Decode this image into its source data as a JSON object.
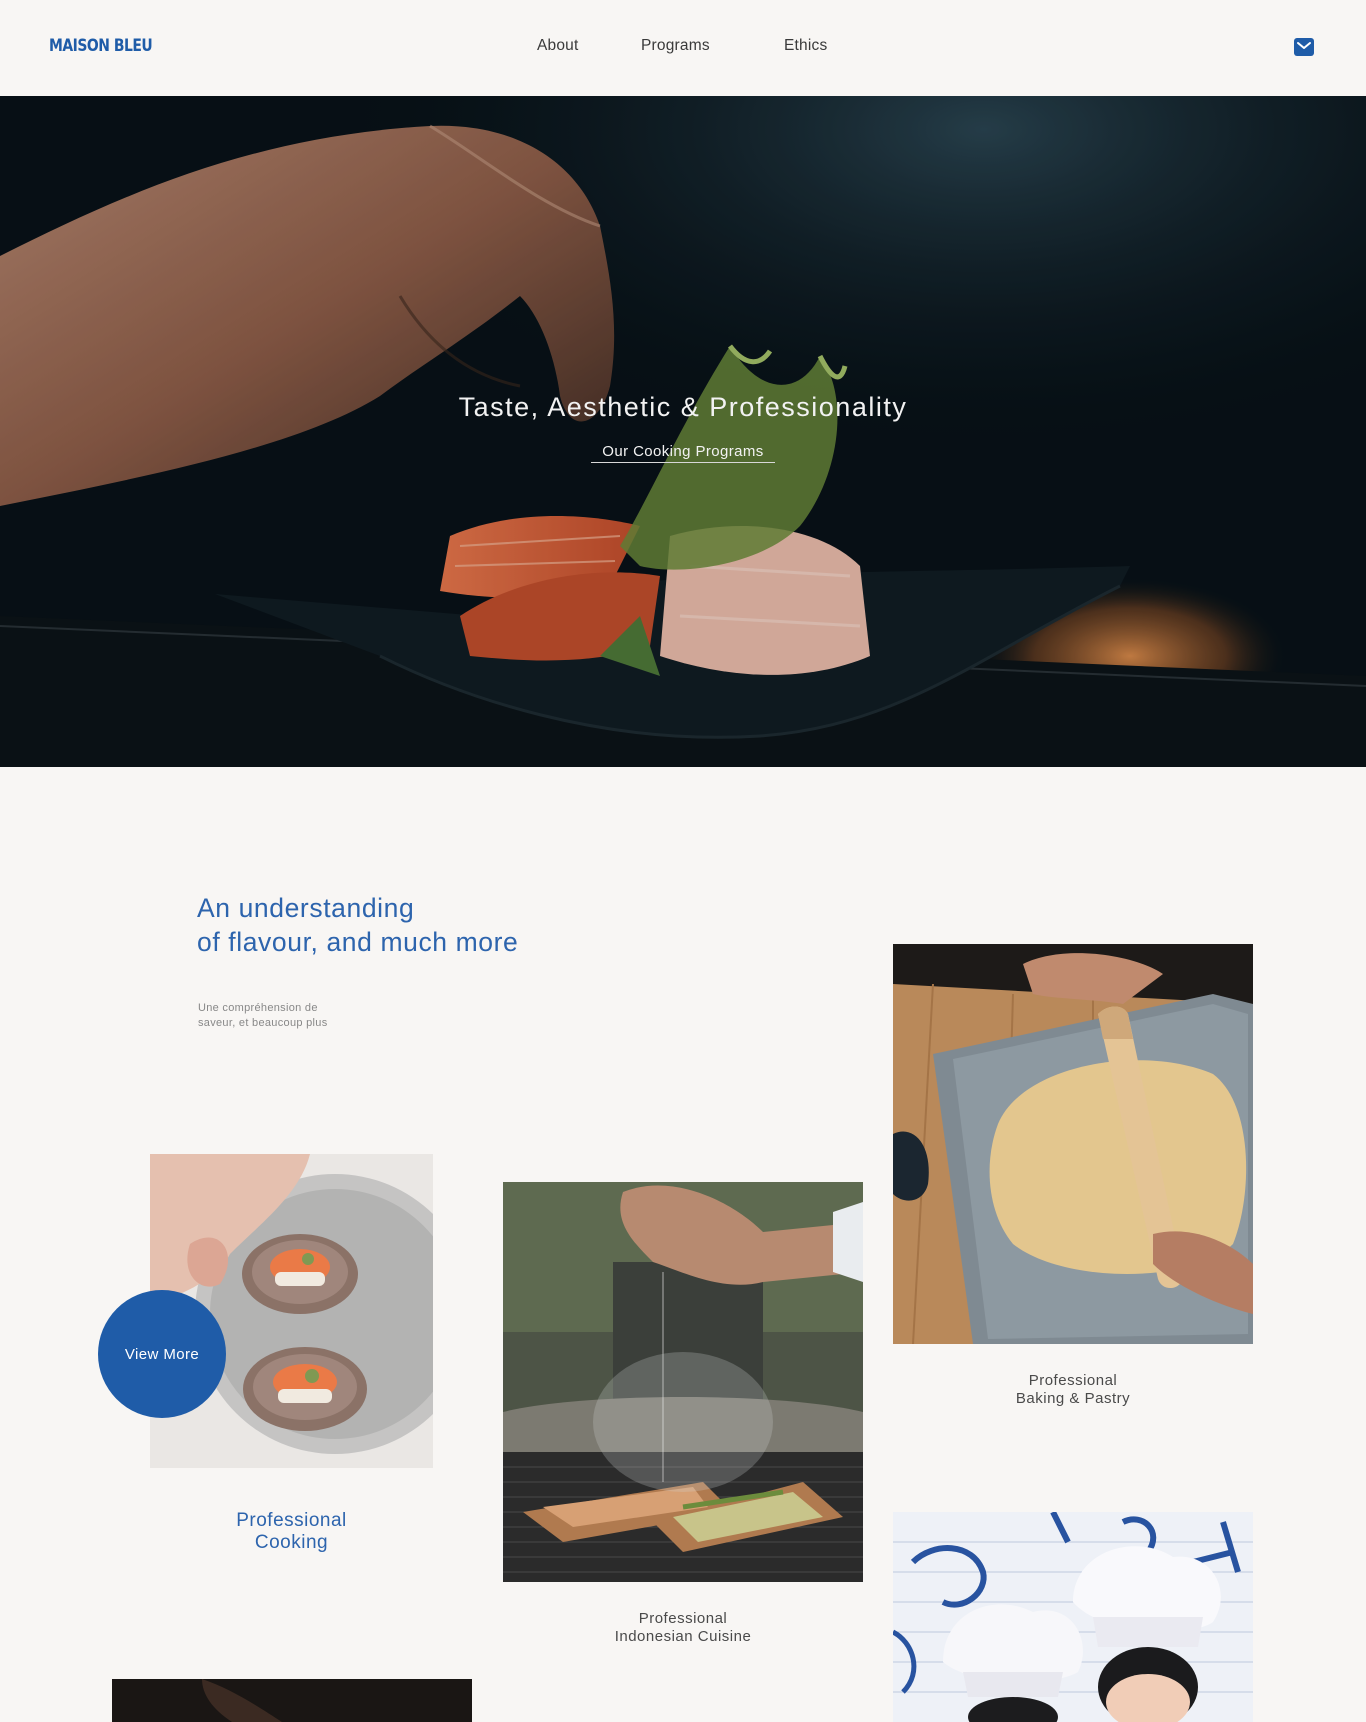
{
  "brand": {
    "name": "MAISON BLEU",
    "accent": "#1f5ca8"
  },
  "nav": {
    "links": [
      {
        "label": "About"
      },
      {
        "label": "Programs"
      },
      {
        "label": "Ethics"
      }
    ],
    "mail_icon": "envelope-icon"
  },
  "hero": {
    "title": "Taste, Aesthetic & Professionality",
    "link": "Our Cooking Programs"
  },
  "intro": {
    "heading_line1": "An understanding",
    "heading_line2": "of flavour, and much more",
    "sub_line1": "Une compréhension de",
    "sub_line2": "saveur, et beaucoup plus"
  },
  "programs": [
    {
      "line1": "Professional",
      "line2": "Cooking"
    },
    {
      "line1": "Professional",
      "line2": "Indonesian Cuisine"
    },
    {
      "line1": "Professional",
      "line2": "Baking & Pastry"
    }
  ],
  "view_more": "View More"
}
